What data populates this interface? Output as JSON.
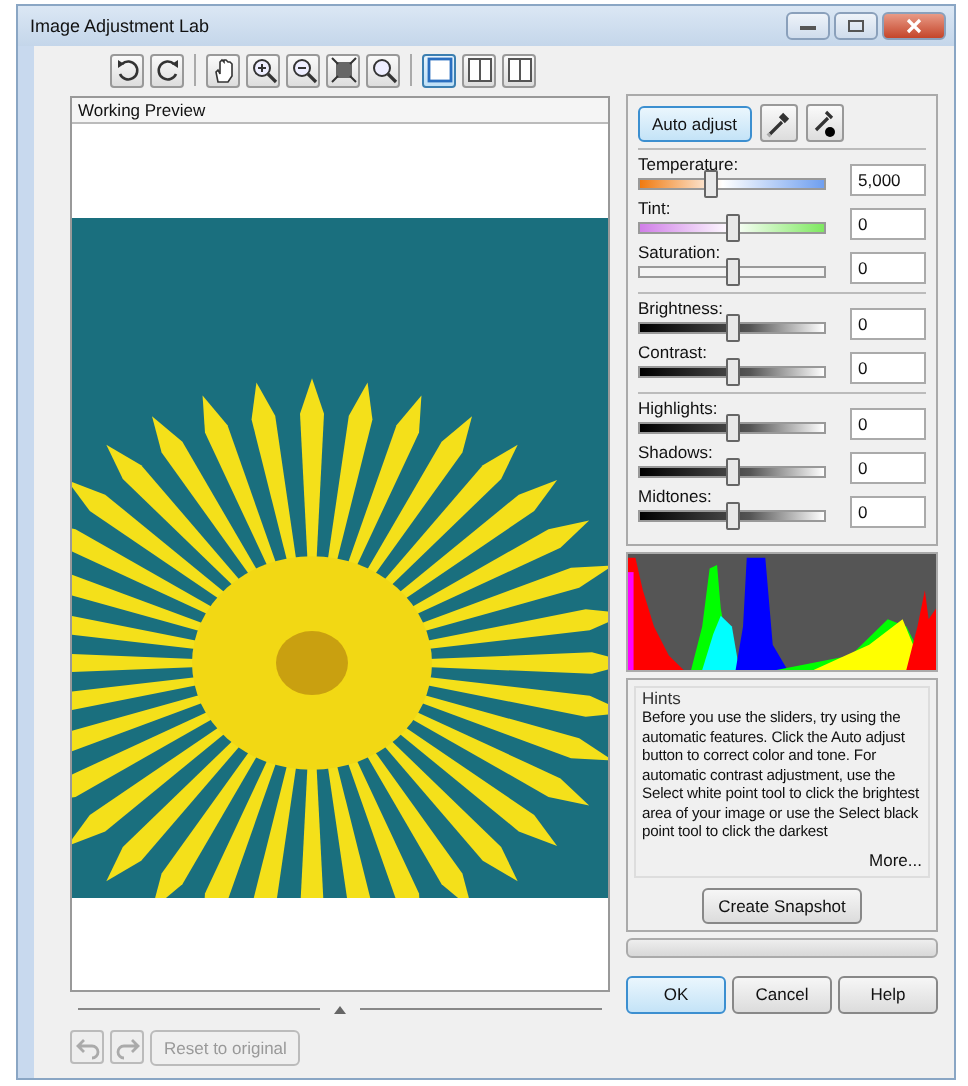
{
  "window": {
    "title": "Image Adjustment Lab"
  },
  "toolbar": [
    {
      "kind": "rotate-left",
      "selected": false
    },
    {
      "kind": "rotate-right",
      "selected": false
    },
    {
      "kind": "hand",
      "selected": false
    },
    {
      "kind": "zoom-in",
      "selected": false
    },
    {
      "kind": "zoom-out",
      "selected": false
    },
    {
      "kind": "fit",
      "selected": false
    },
    {
      "kind": "zoom-actual",
      "selected": false
    },
    {
      "kind": "single",
      "selected": true
    },
    {
      "kind": "split",
      "selected": false
    },
    {
      "kind": "side",
      "selected": false
    }
  ],
  "preview": {
    "title": "Working Preview"
  },
  "bottom_left": {
    "undo_disabled": true,
    "redo_disabled": true,
    "reset": {
      "label": "Reset to original",
      "disabled": true
    }
  },
  "auto_adjust": "Auto adjust",
  "slider_groups": [
    [
      {
        "label": "Temperature:",
        "kind": "temperature",
        "level": 0.38,
        "value": "5,000"
      },
      {
        "label": "Tint:",
        "kind": "tint",
        "level": 0.5,
        "value": "0"
      },
      {
        "label": "Saturation:",
        "kind": "plain",
        "level": 0.5,
        "value": "0"
      }
    ],
    [
      {
        "label": "Brightness:",
        "kind": "dark",
        "level": 0.5,
        "value": "0"
      },
      {
        "label": "Contrast:",
        "kind": "dark",
        "level": 0.5,
        "value": "0"
      }
    ],
    [
      {
        "label": "Highlights:",
        "kind": "dark",
        "level": 0.5,
        "value": "0"
      },
      {
        "label": "Shadows:",
        "kind": "dark",
        "level": 0.5,
        "value": "0"
      },
      {
        "label": "Midtones:",
        "kind": "dark",
        "level": 0.5,
        "value": "0"
      }
    ]
  ],
  "hints": {
    "title": "Hints",
    "text": "Before you use the sliders, try using the automatic features. Click the Auto adjust button to correct color and tone. For automatic contrast adjustment, use the Select white point tool to click the brightest area of your image or use the Select black point tool to click the darkest",
    "more": "More..."
  },
  "snapshot_button": "Create Snapshot",
  "progress": {
    "level": 0
  },
  "buttons": [
    {
      "label": "OK",
      "selected": true
    },
    {
      "label": "Cancel",
      "selected": false
    },
    {
      "label": "Help",
      "selected": false
    }
  ]
}
